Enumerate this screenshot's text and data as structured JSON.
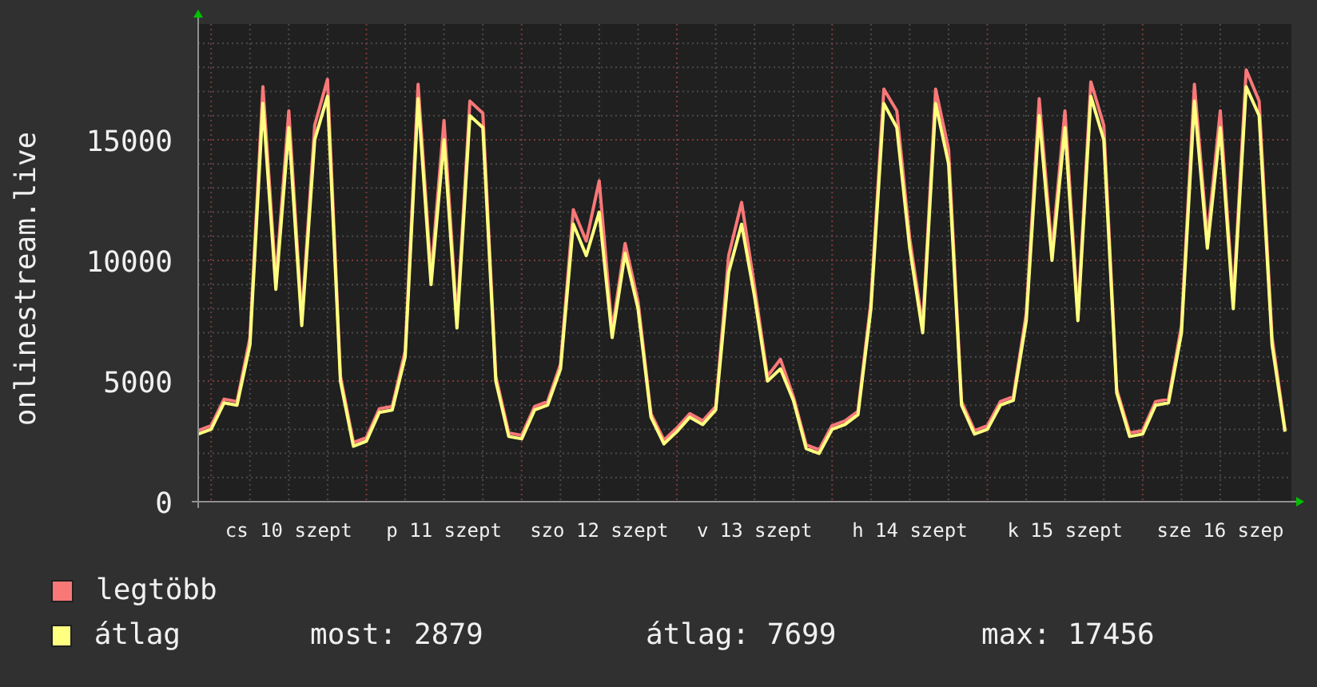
{
  "chart": {
    "chart_data": {
      "type": "line",
      "ylabel": "onlinestream.live",
      "categories": [
        null,
        null,
        null,
        null,
        null,
        null,
        null,
        "cs 10 szept",
        null,
        null,
        null,
        null,
        null,
        null,
        null,
        null,
        null,
        null,
        null,
        "p 11 szept",
        null,
        null,
        null,
        null,
        null,
        null,
        null,
        null,
        null,
        null,
        null,
        "szo 12 szept",
        null,
        null,
        null,
        null,
        null,
        null,
        null,
        null,
        null,
        null,
        null,
        "v 13 szept",
        null,
        null,
        null,
        null,
        null,
        null,
        null,
        null,
        null,
        null,
        null,
        "h 14 szept",
        null,
        null,
        null,
        null,
        null,
        null,
        null,
        null,
        null,
        null,
        null,
        "k 15 szept",
        null,
        null,
        null,
        null,
        null,
        null,
        null,
        null,
        null,
        null,
        null,
        "sze 16 szep",
        null,
        null,
        null,
        null,
        null
      ],
      "series": [
        {
          "name": "legtöbb",
          "color": "#f87878",
          "values": [
            2950,
            3150,
            4250,
            4150,
            6800,
            17200,
            9200,
            16200,
            7600,
            15600,
            17500,
            5200,
            2450,
            2650,
            3850,
            3950,
            6250,
            17300,
            9400,
            15800,
            7500,
            16600,
            16100,
            5200,
            2850,
            2750,
            3950,
            4150,
            5700,
            12100,
            10800,
            13300,
            7100,
            10700,
            8300,
            3650,
            2550,
            3050,
            3650,
            3350,
            3950,
            10200,
            12400,
            8900,
            5200,
            5900,
            4350,
            2350,
            2150,
            3150,
            3350,
            3750,
            8300,
            17100,
            16200,
            10900,
            7300,
            17100,
            14600,
            4150,
            2950,
            3150,
            4150,
            4350,
            7800,
            16700,
            10400,
            16200,
            7800,
            17400,
            15600,
            4650,
            2850,
            2950,
            4150,
            4250,
            7300,
            17300,
            10900,
            16200,
            8300,
            17900,
            16600,
            6800,
            3000
          ]
        },
        {
          "name": "átlag",
          "color": "#ffff80",
          "values": [
            2800,
            3000,
            4100,
            4000,
            6500,
            16500,
            8800,
            15500,
            7300,
            15000,
            16800,
            5000,
            2300,
            2500,
            3700,
            3800,
            6000,
            16700,
            9000,
            15000,
            7200,
            16000,
            15500,
            5000,
            2700,
            2600,
            3800,
            4000,
            5500,
            11500,
            10200,
            12000,
            6800,
            10300,
            8000,
            3500,
            2400,
            2900,
            3500,
            3200,
            3800,
            9500,
            11500,
            8500,
            5000,
            5500,
            4200,
            2200,
            2000,
            3000,
            3200,
            3600,
            8000,
            16500,
            15500,
            10500,
            7000,
            16500,
            14000,
            4000,
            2800,
            3000,
            4000,
            4200,
            7500,
            16000,
            10000,
            15500,
            7500,
            16800,
            15000,
            4500,
            2700,
            2800,
            4000,
            4100,
            7000,
            16600,
            10500,
            15500,
            8000,
            17200,
            16000,
            6500,
            2900
          ]
        }
      ],
      "ylim": [
        0,
        19800
      ],
      "yticks": [
        0,
        5000,
        10000,
        15000
      ],
      "grid": true
    }
  },
  "legend": {
    "stats": [
      "most: 2879",
      "átlag: 7699",
      "max: 17456"
    ]
  }
}
